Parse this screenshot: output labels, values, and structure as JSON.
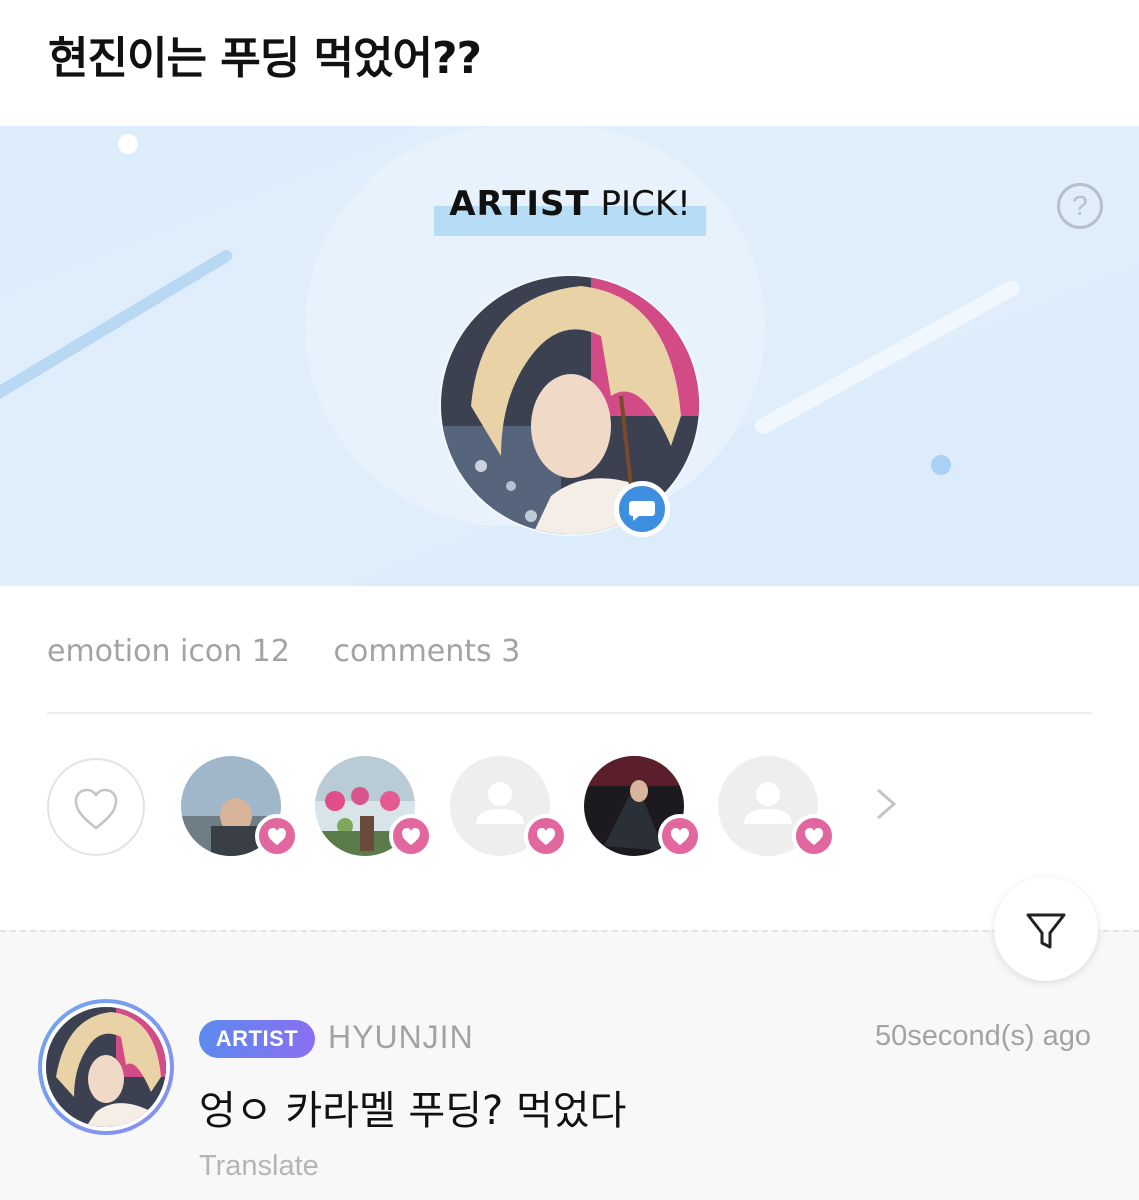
{
  "post": {
    "title": "현진이는 푸딩 먹었어??"
  },
  "banner": {
    "pick_bold": "ARTIST",
    "pick_rest": " PICK!",
    "help_label": "?",
    "avatar": "artist-photo",
    "badge_icon": "chat-bubble-icon"
  },
  "stats": {
    "emotion": "emotion icon 12",
    "comments": "comments 3"
  },
  "reactions": {
    "heart_icon": "heart-outline-icon",
    "more_icon": "chevron-right-icon",
    "users": [
      {
        "type": "photo",
        "badge": "heart-icon"
      },
      {
        "type": "photo",
        "badge": "heart-icon"
      },
      {
        "type": "placeholder",
        "badge": "heart-icon"
      },
      {
        "type": "photo",
        "badge": "heart-icon"
      },
      {
        "type": "placeholder",
        "badge": "heart-icon"
      }
    ]
  },
  "filter": {
    "icon": "filter-icon"
  },
  "comment": {
    "badge": "ARTIST",
    "name": "HYUNJIN",
    "time": "50second(s) ago",
    "text": "엉ㅇ 카라멜 푸딩? 먹었다",
    "translate": "Translate"
  },
  "colors": {
    "banner_bg": "#dcecfb",
    "heart_pink": "#e2679f",
    "artist_badge": "#6f80f0",
    "message_blue": "#3e8fe0"
  }
}
